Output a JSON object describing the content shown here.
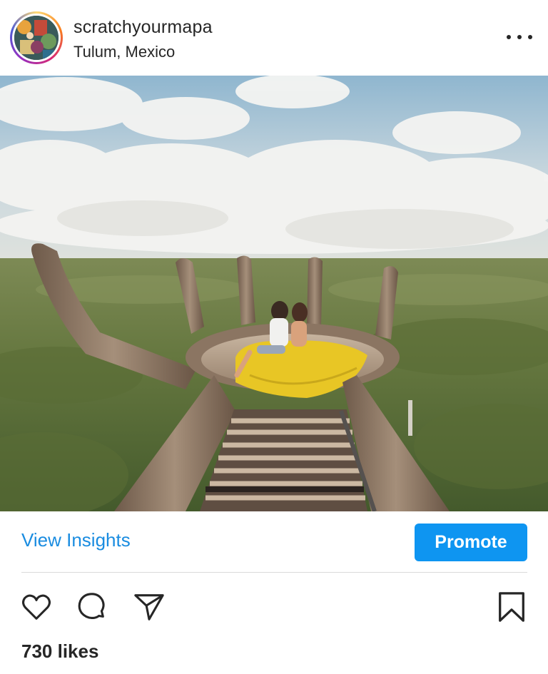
{
  "post": {
    "username": "scratchyourmapa",
    "location": "Tulum, Mexico",
    "likes": "730 likes"
  },
  "actions": {
    "view_insights": "View Insights",
    "promote": "Promote"
  },
  "icons": {
    "more": "more-horizontal-icon",
    "like": "heart-icon",
    "comment": "comment-icon",
    "share": "paper-plane-icon",
    "save": "bookmark-icon"
  },
  "colors": {
    "accent": "#0e95f1",
    "link": "#1a8ce0",
    "text": "#262626",
    "divider": "#dbdbdb"
  }
}
